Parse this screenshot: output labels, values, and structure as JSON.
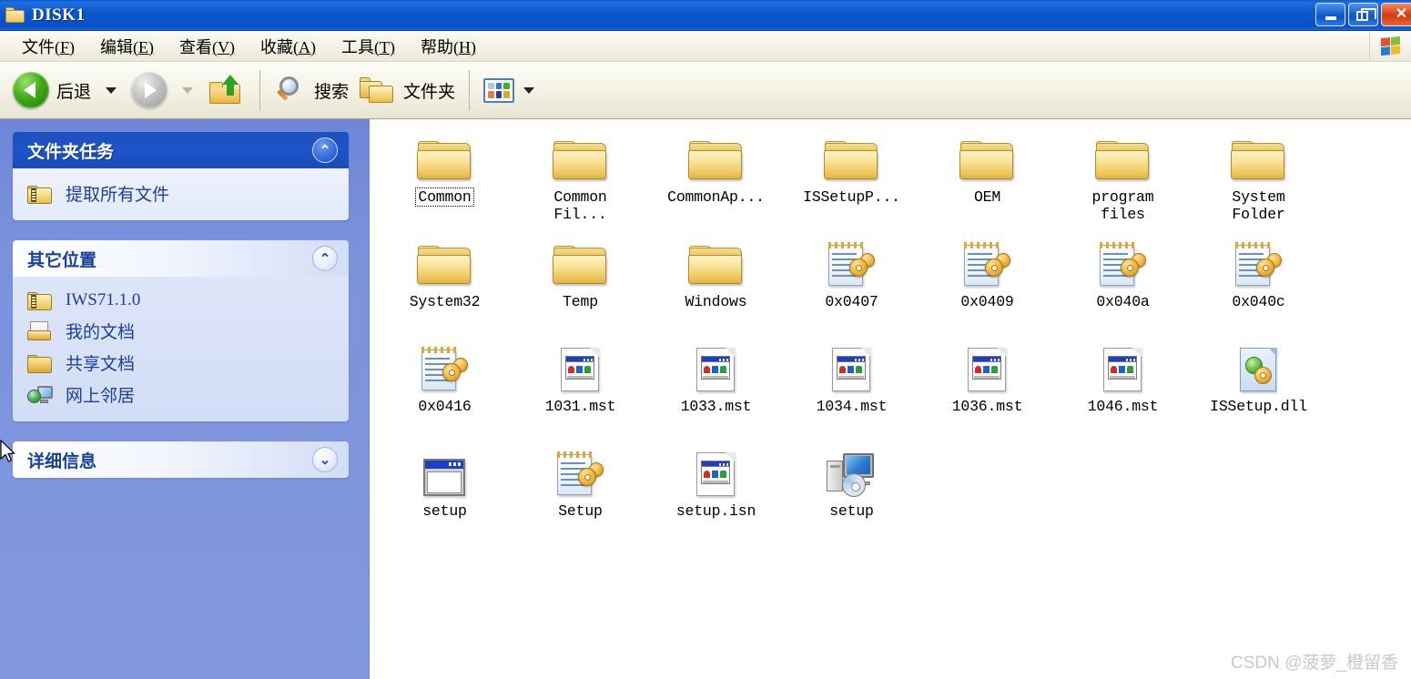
{
  "window": {
    "title": "DISK1",
    "title_icon": "folder-icon",
    "caption": {
      "minimize": "–",
      "maximize": "❐",
      "close": "✕"
    }
  },
  "menubar": {
    "items": [
      {
        "label": "文件",
        "accel": "(F)"
      },
      {
        "label": "编辑",
        "accel": "(E)"
      },
      {
        "label": "查看",
        "accel": "(V)"
      },
      {
        "label": "收藏",
        "accel": "(A)"
      },
      {
        "label": "工具",
        "accel": "(T)"
      },
      {
        "label": "帮助",
        "accel": "(H)"
      }
    ],
    "brand_icon": "windows-flag-icon"
  },
  "toolbar": {
    "back_label": "后退",
    "forward_label": "",
    "up_icon": "up-folder-icon",
    "search_label": "搜索",
    "folders_label": "文件夹",
    "views_icon": "views-icon"
  },
  "sidebar": {
    "panels": [
      {
        "title": "文件夹任务",
        "style": "blue",
        "chevron": "⌃",
        "collapsed": false,
        "items": [
          {
            "label": "提取所有文件",
            "icon": "zipped-folder-icon"
          }
        ]
      },
      {
        "title": "其它位置",
        "style": "white",
        "chevron": "⌃",
        "collapsed": false,
        "items": [
          {
            "label": "IWS71.1.0",
            "icon": "zipped-folder-icon"
          },
          {
            "label": "我的文档",
            "icon": "my-documents-icon"
          },
          {
            "label": "共享文档",
            "icon": "shared-documents-icon"
          },
          {
            "label": "网上邻居",
            "icon": "network-places-icon"
          }
        ]
      },
      {
        "title": "详细信息",
        "style": "white",
        "chevron": "⌄",
        "collapsed": true,
        "items": []
      }
    ]
  },
  "files": [
    {
      "name": "Common",
      "icon": "folder-icon",
      "focused": true
    },
    {
      "name": "Common\nFil...",
      "icon": "folder-icon",
      "focused": false
    },
    {
      "name": "CommonAp...",
      "icon": "folder-icon",
      "focused": false
    },
    {
      "name": "ISSetupP...",
      "icon": "folder-icon",
      "focused": false
    },
    {
      "name": "OEM",
      "icon": "folder-icon",
      "focused": false
    },
    {
      "name": "program\nfiles",
      "icon": "folder-icon",
      "focused": false
    },
    {
      "name": "System\nFolder",
      "icon": "folder-icon",
      "focused": false
    },
    {
      "name": "System32",
      "icon": "folder-icon",
      "focused": false
    },
    {
      "name": "Temp",
      "icon": "folder-icon",
      "focused": false
    },
    {
      "name": "Windows",
      "icon": "folder-icon",
      "focused": false
    },
    {
      "name": "0x0407",
      "icon": "notepad-gear-icon",
      "focused": false
    },
    {
      "name": "0x0409",
      "icon": "notepad-gear-icon",
      "focused": false
    },
    {
      "name": "0x040a",
      "icon": "notepad-gear-icon",
      "focused": false
    },
    {
      "name": "0x040c",
      "icon": "notepad-gear-icon",
      "focused": false
    },
    {
      "name": "0x0416",
      "icon": "notepad-gear-icon",
      "focused": false
    },
    {
      "name": "1031.mst",
      "icon": "mst-document-icon",
      "focused": false
    },
    {
      "name": "1033.mst",
      "icon": "mst-document-icon",
      "focused": false
    },
    {
      "name": "1034.mst",
      "icon": "mst-document-icon",
      "focused": false
    },
    {
      "name": "1036.mst",
      "icon": "mst-document-icon",
      "focused": false
    },
    {
      "name": "1046.mst",
      "icon": "mst-document-icon",
      "focused": false
    },
    {
      "name": "ISSetup.dll",
      "icon": "dll-gears-icon",
      "focused": false
    },
    {
      "name": "setup",
      "icon": "window-config-icon",
      "focused": false
    },
    {
      "name": "Setup",
      "icon": "notepad-gear-icon",
      "focused": false
    },
    {
      "name": "setup.isn",
      "icon": "mst-document-icon",
      "focused": false
    },
    {
      "name": "setup",
      "icon": "computer-cd-icon",
      "focused": false
    }
  ],
  "watermark": "CSDN @菠萝_橙留香",
  "colors": {
    "titlebar": "#0c57d0",
    "sidebar_bg": "#7b93dd",
    "panel_header_blue": "#1e54c9",
    "link_text": "#1c3f9e"
  }
}
